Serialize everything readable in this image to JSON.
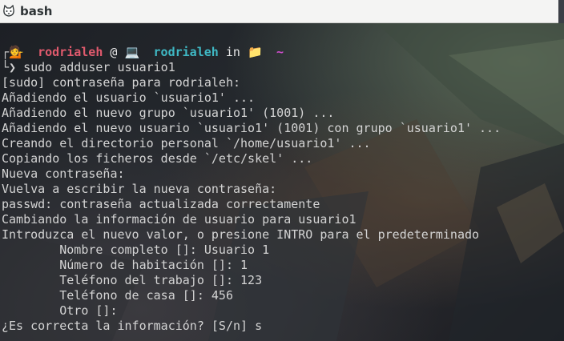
{
  "window": {
    "title": "bash",
    "app_icon": "terminal-cat-icon"
  },
  "prompt": {
    "user": "rodrialeh",
    "at": "@",
    "laptop_icon": "laptop-icon",
    "host": "rodrialeh",
    "in": "in",
    "folder_icon": "folder-icon",
    "tilde": "~",
    "person_icon": "person-tipping-hand-icon",
    "arrow": "❯"
  },
  "command": "sudo adduser usuario1",
  "output": [
    "[sudo] contraseña para rodrialeh:",
    "Añadiendo el usuario `usuario1' ...",
    "Añadiendo el nuevo grupo `usuario1' (1001) ...",
    "Añadiendo el nuevo usuario `usuario1' (1001) con grupo `usuario1' ...",
    "Creando el directorio personal `/home/usuario1' ...",
    "Copiando los ficheros desde `/etc/skel' ...",
    "Nueva contraseña:",
    "Vuelva a escribir la nueva contraseña:",
    "passwd: contraseña actualizada correctamente",
    "Cambiando la información de usuario para usuario1",
    "Introduzca el nuevo valor, o presione INTRO para el predeterminado",
    "\tNombre completo []: Usuario 1",
    "\tNúmero de habitación []: 1",
    "\tTeléfono del trabajo []: 123",
    "\tTeléfono de casa []: 456",
    "\tOtro []:",
    "¿Es correcta la información? [S/n] s"
  ],
  "colors": {
    "user": "#e05a6d",
    "host": "#3fb8c4",
    "tilde": "#d14ecf",
    "text": "#d4d4d4"
  }
}
